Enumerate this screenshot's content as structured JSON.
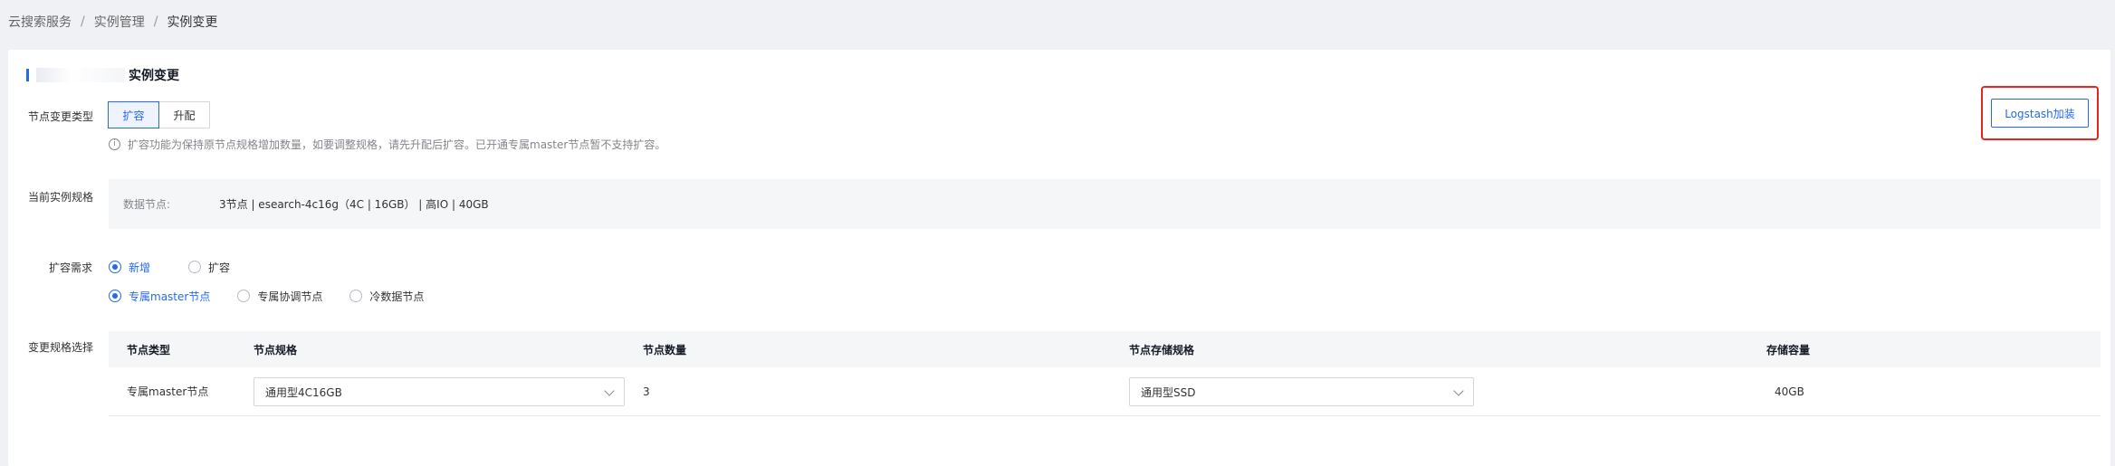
{
  "breadcrumb": {
    "items": [
      "云搜索服务",
      "实例管理",
      "实例变更"
    ]
  },
  "page": {
    "title": "实例变更"
  },
  "change_type": {
    "label": "节点变更类型",
    "options": [
      "扩容",
      "升配"
    ],
    "selected": "扩容",
    "tip": "扩容功能为保持原节点规格增加数量，如要调整规格，请先升配后扩容。已开通专属master节点暂不支持扩容。"
  },
  "logstash": {
    "button_label": "Logstash加装"
  },
  "current_spec": {
    "label": "当前实例规格",
    "key": "数据节点:",
    "value": "3节点 | esearch-4c16g（4C | 16GB） | 高IO | 40GB"
  },
  "expand_need": {
    "label": "扩容需求",
    "row1": [
      {
        "label": "新增",
        "checked": true
      },
      {
        "label": "扩容",
        "checked": false
      }
    ],
    "row2": [
      {
        "label": "专属master节点",
        "checked": true
      },
      {
        "label": "专属协调节点",
        "checked": false
      },
      {
        "label": "冷数据节点",
        "checked": false
      }
    ]
  },
  "spec_select": {
    "label": "变更规格选择",
    "columns": [
      "节点类型",
      "节点规格",
      "节点数量",
      "节点存储规格",
      "存储容量"
    ],
    "rows": [
      {
        "node_type": "专属master节点",
        "node_spec": "通用型4C16GB",
        "node_count": "3",
        "storage_spec": "通用型SSD",
        "capacity": "40GB"
      }
    ]
  },
  "colors": {
    "primary": "#2468f2",
    "highlight_border": "#e8251e",
    "page_bg": "#f0f1f5"
  }
}
